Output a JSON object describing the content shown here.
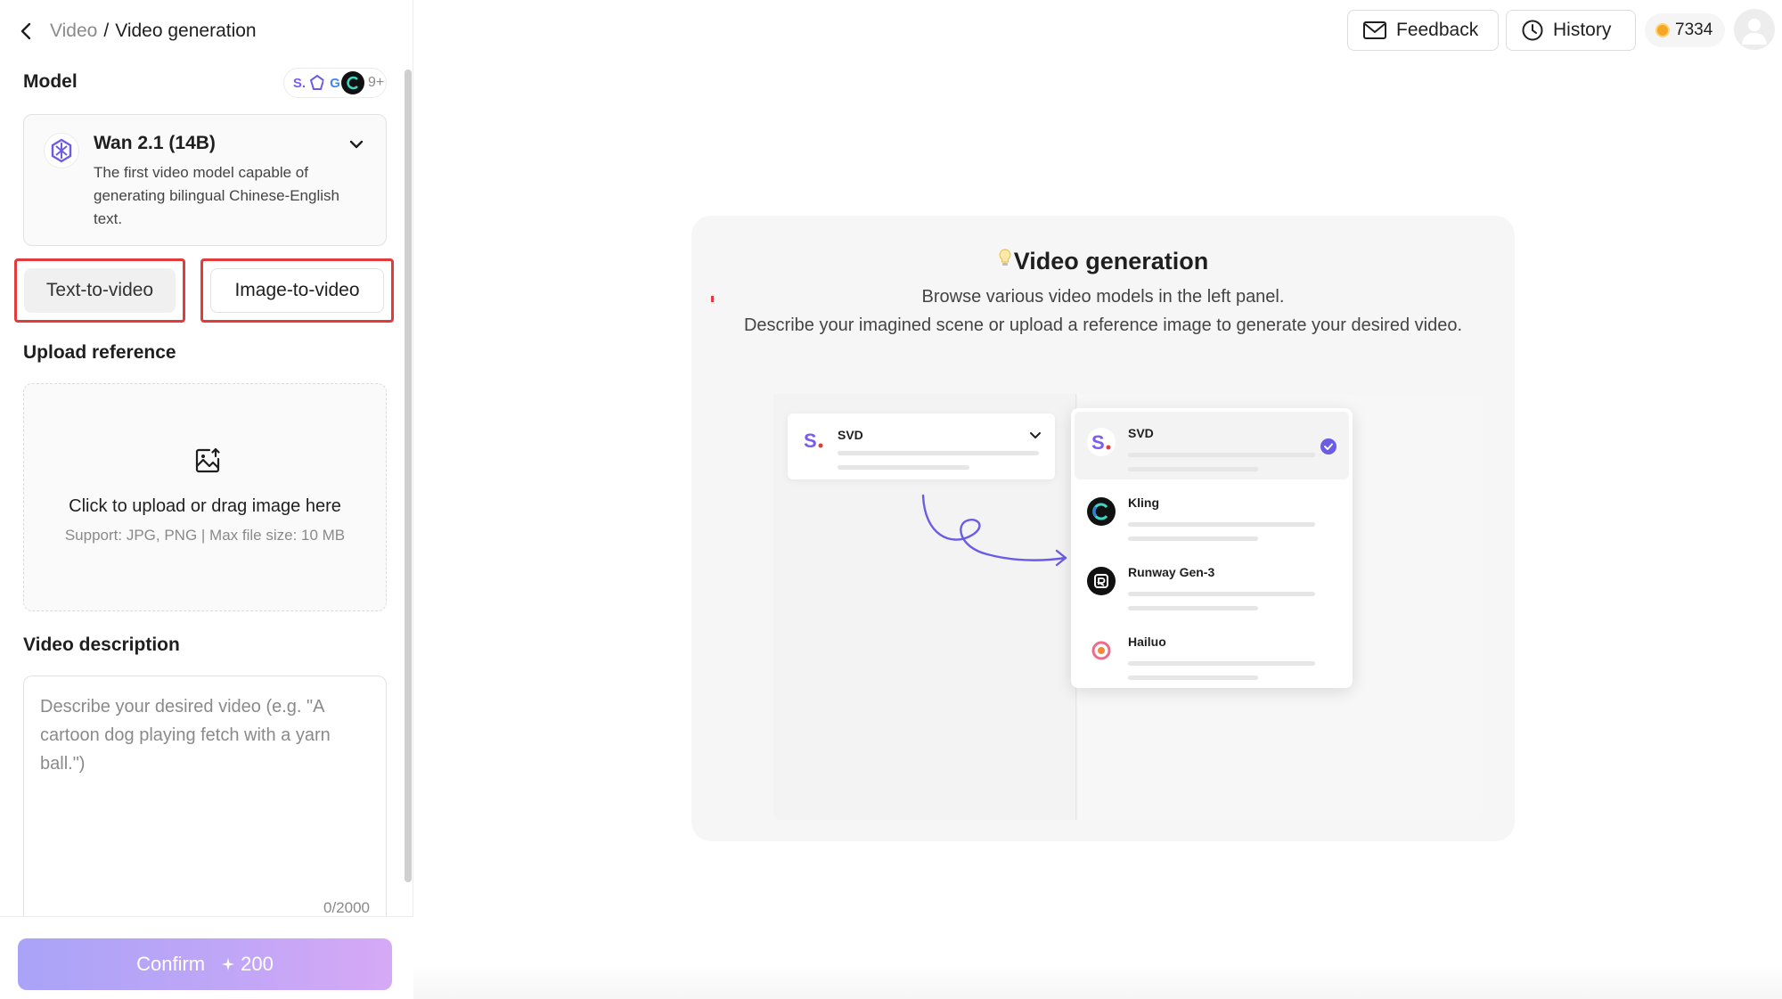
{
  "breadcrumb": {
    "parent": "Video",
    "separator": "/",
    "current": "Video generation"
  },
  "model": {
    "section_label": "Model",
    "badges_more": "9+",
    "selected": {
      "name": "Wan 2.1 (14B)",
      "description": "The first video model capable of generating bilingual Chinese-English text."
    }
  },
  "modes": {
    "text_to_video": "Text-to-video",
    "image_to_video": "Image-to-video"
  },
  "upload": {
    "section_label": "Upload reference",
    "title": "Click to upload or drag image here",
    "subtitle": "Support: JPG, PNG | Max file size: 10 MB"
  },
  "description": {
    "section_label": "Video description",
    "value": "",
    "placeholder": "Describe your desired video (e.g. \"A cartoon dog playing fetch with a yarn ball.\")",
    "counter": "0/2000"
  },
  "confirm": {
    "label": "Confirm",
    "cost": "200"
  },
  "header": {
    "feedback": "Feedback",
    "history": "History",
    "credits": "7334"
  },
  "intro": {
    "title": "Video generation",
    "line1": "Browse various video models in the left panel.",
    "line2": "Describe your imagined scene or upload a reference image to generate your desired video."
  },
  "illustration": {
    "select_value": "SVD",
    "options": [
      {
        "name": "SVD",
        "selected": true
      },
      {
        "name": "Kling",
        "selected": false
      },
      {
        "name": "Runway Gen-3",
        "selected": false
      },
      {
        "name": "Hailuo",
        "selected": false
      }
    ]
  },
  "colors": {
    "accent": "#6b5ce7",
    "highlight_border": "#e23b3b",
    "confirm_start": "#a9a3f7",
    "confirm_end": "#d6a9f5"
  }
}
